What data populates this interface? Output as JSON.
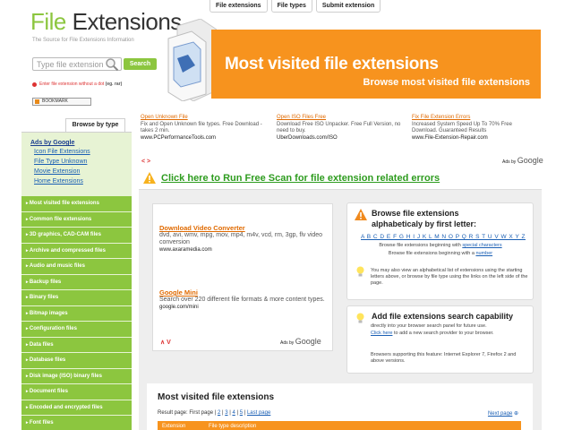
{
  "topnav": [
    "File extensions",
    "File types",
    "Submit extension"
  ],
  "logo": {
    "part1": "File",
    "part2": " Extensions",
    "tagline": "The Source for File Extensions Information"
  },
  "search": {
    "placeholder": "Type file extension",
    "button": "Search",
    "hint_prefix": "Enter file extension without a dot ",
    "hint_example": "(eg. rar)"
  },
  "bookmark": "BOOKMARK",
  "banner": {
    "title": "Most visited file extensions",
    "subtitle": "Browse most visited file extensions"
  },
  "sidebar": {
    "tab": "Browse by type",
    "ads_head": "Ads by Google",
    "ad_links": [
      "Icon File Extensions",
      "File Type Unknown",
      "Movie Extension",
      "Home Extensions"
    ],
    "nav": [
      "Most visited file extensions",
      "Common file extensions",
      "3D graphics, CAD-CAM files",
      "Archive and compressed files",
      "Audio and music files",
      "Backup files",
      "Binary files",
      "Bitmap images",
      "Configuration files",
      "Data files",
      "Database files",
      "Disk image (ISO) binary files",
      "Document files",
      "Encoded and encrypted files",
      "Font files"
    ]
  },
  "ads": [
    {
      "head": "Open Unknown File",
      "body": "Fix and Open Unknown file types. Free Download - takes 2 min.",
      "url": "www.PCPerformanceTools.com"
    },
    {
      "head": "Open ISO Files Free",
      "body": "Download Free ISO Unpacker. Free Full Version, no need to buy.",
      "url": "UberDownloads.com/ISO"
    },
    {
      "head": "Fix File Extension Errors",
      "body": "Increased System Speed Up To 70% Free Download. Guaranteed Results",
      "url": "www.File-Extension-Repair.com"
    }
  ],
  "ads_by_google": {
    "label": "Ads by",
    "brand": "Google"
  },
  "arrows": "< >",
  "scan": "Click here to Run Free Scan for file extension related errors",
  "main_ads": [
    {
      "head": "Download Video Converter",
      "body": "dvd, avi, wmv, mpg, mov, mp4, m4v, vcd, rm, 3gp, flv video conversion",
      "url": "www.axaramedia.com"
    },
    {
      "head": "Google Mini",
      "body": "Search over 220 different file formats & more content types.",
      "url": "google.com/mini"
    }
  ],
  "main_arrows": "∧ V",
  "browse_box": {
    "title_line1": "Browse file extensions",
    "title_line2": "alphabeticaly by first letter:",
    "letters": "A B C D E F G H I J K L M N O P Q R S T U V W X Y Z",
    "special_prefix": "Browse file extensions beginning with ",
    "special_link": "special characters",
    "number_prefix": "Browse file extensions beginning with a ",
    "number_link": "number",
    "note": "You may also view an alphabetical list of extensions using the starting letters above, or browse by file type using the links on the left side of the page."
  },
  "search_box": {
    "title": "Add file extensions search capability",
    "line1": "directly into your browser search panel for future use.",
    "click": "Click here",
    "line2": " to add a new search provider to your browser.",
    "support": "Browsers supporting this feature: Internet Explorer 7, Firefox 2 and above versions."
  },
  "most_visited": {
    "title": "Most visited file extensions",
    "result_label": "Result page: First page",
    "pages": [
      "2",
      "3",
      "4",
      "5"
    ],
    "last_page": "Last page",
    "next_page": "Next page",
    "columns": [
      "Extension",
      "File type description"
    ]
  },
  "colors": {
    "green": "#8cc63f",
    "orange": "#f7931e",
    "link": "#1a5fb4"
  }
}
